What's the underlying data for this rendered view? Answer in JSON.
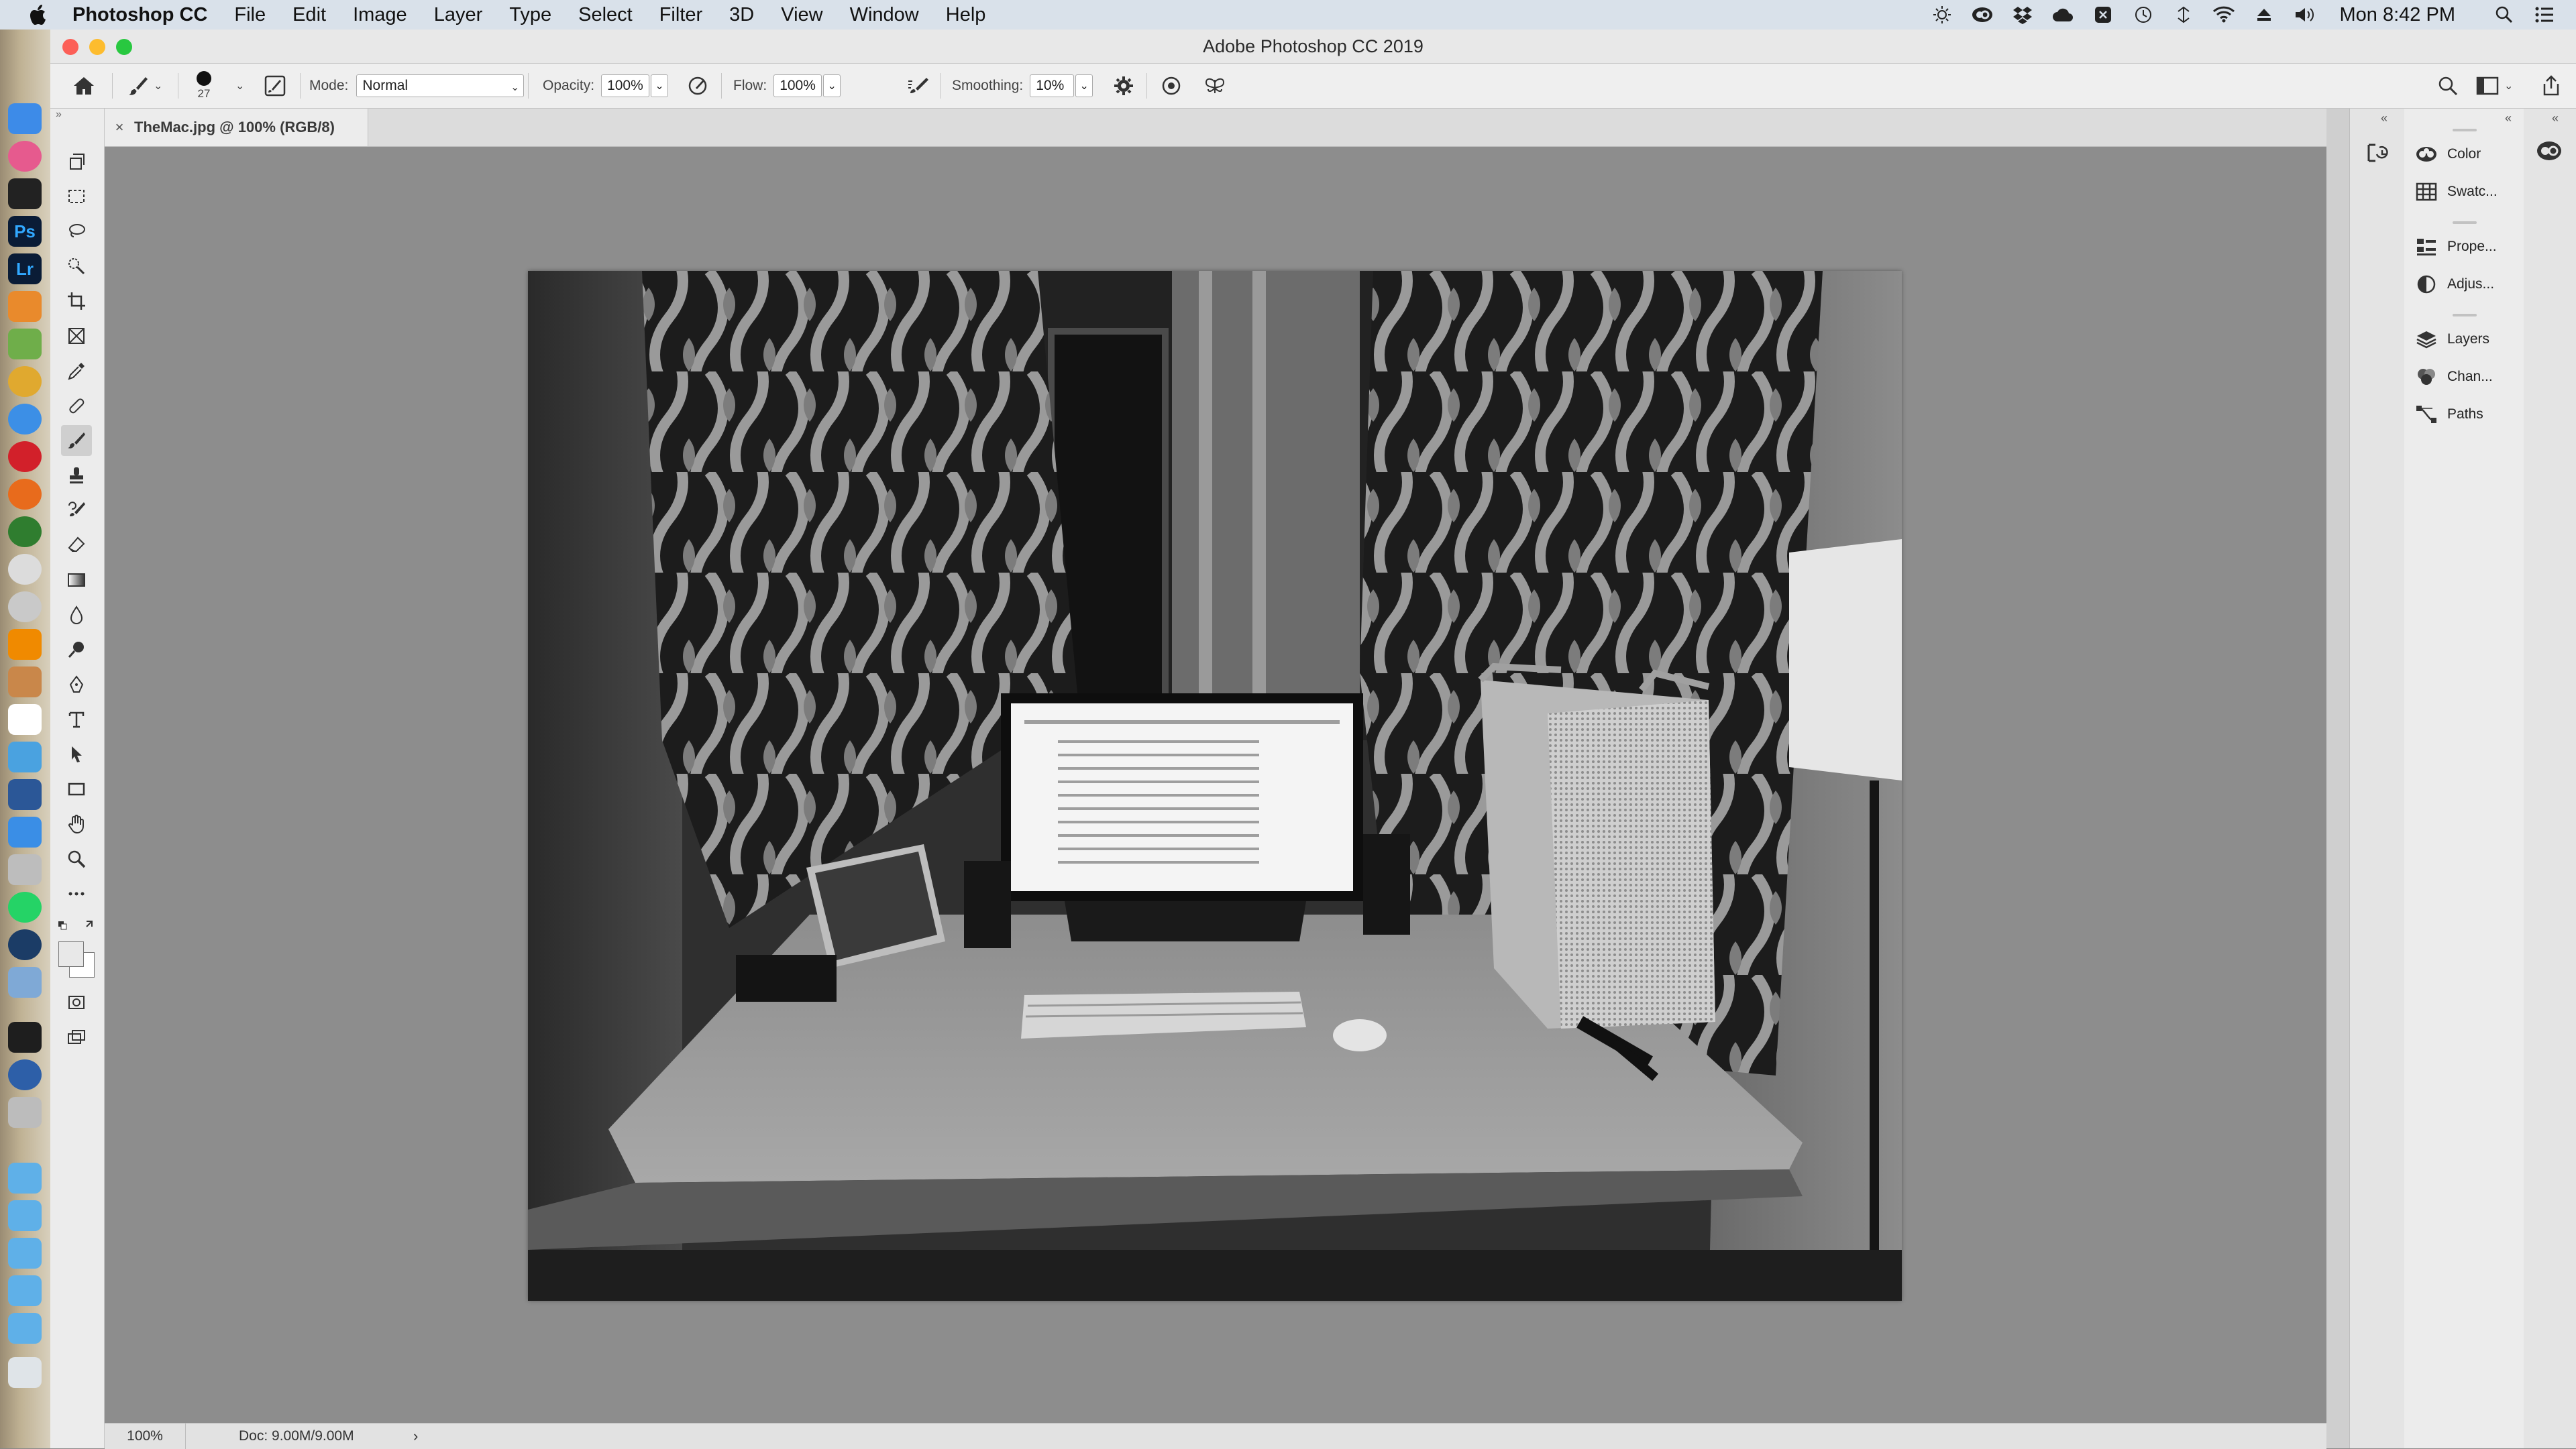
{
  "menubar": {
    "app_name": "Photoshop CC",
    "items": [
      "File",
      "Edit",
      "Image",
      "Layer",
      "Type",
      "Select",
      "Filter",
      "3D",
      "View",
      "Window",
      "Help"
    ],
    "clock": "Mon 8:42 PM",
    "status_icons": [
      "brightness-icon",
      "creative-cloud-icon",
      "dropbox-icon",
      "cloud-icon",
      "bluetooth-like-icon",
      "time-machine-icon",
      "sync-icon",
      "wifi-icon",
      "eject-icon",
      "volume-icon",
      "spotlight-icon",
      "notification-center-icon"
    ]
  },
  "window": {
    "title": "Adobe Photoshop CC 2019"
  },
  "options": {
    "brush_size": "27",
    "mode_label": "Mode:",
    "mode_value": "Normal",
    "opacity_label": "Opacity:",
    "opacity_value": "100%",
    "flow_label": "Flow:",
    "flow_value": "100%",
    "smoothing_label": "Smoothing:",
    "smoothing_value": "10%"
  },
  "document": {
    "tab_title": "TheMac.jpg @ 100% (RGB/8)",
    "zoom": "100%",
    "doc_info": "Doc: 9.00M/9.00M"
  },
  "panels": {
    "group1": [
      "Color",
      "Swatc..."
    ],
    "group2": [
      "Prope...",
      "Adjus..."
    ],
    "group3": [
      "Layers",
      "Chan...",
      "Paths"
    ]
  },
  "colors": {
    "menubar_bg": "#d9e1ea",
    "panel_bg": "#ececec",
    "workspace_bg": "#8d8d8d"
  }
}
